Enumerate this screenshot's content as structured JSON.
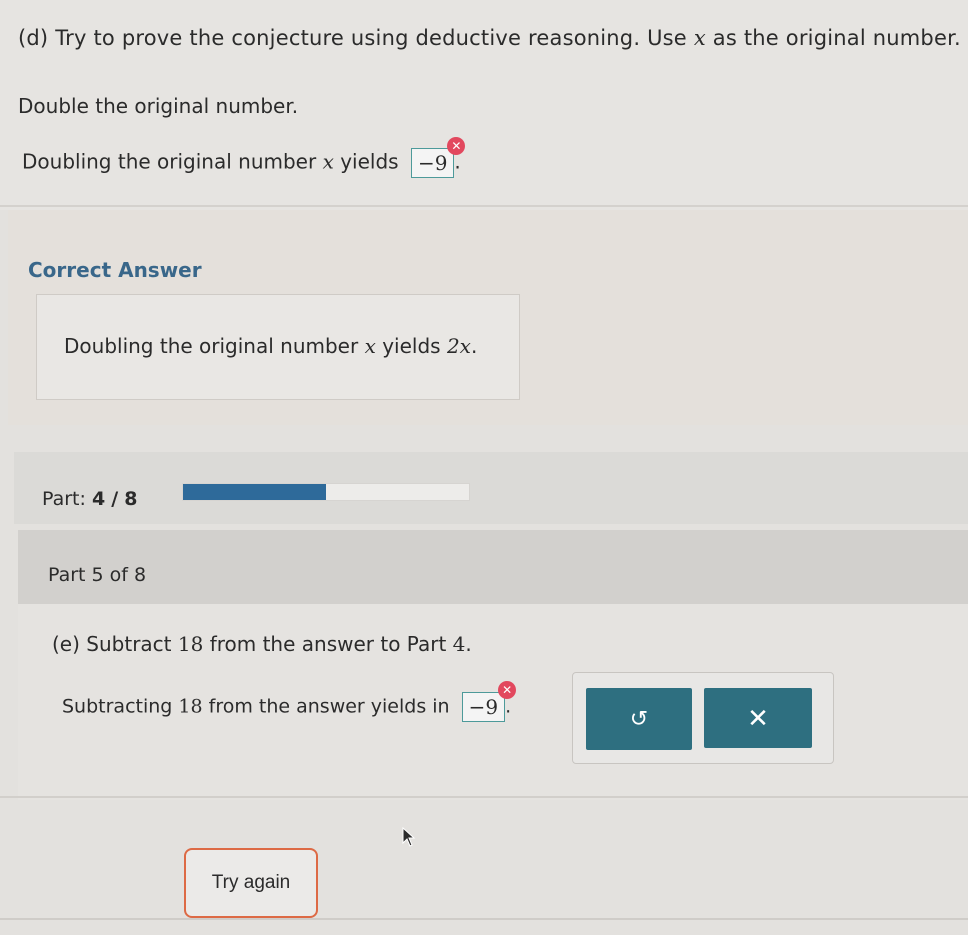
{
  "part_d": {
    "label": "(d)",
    "question": "Try to prove the conjecture using deductive reasoning. Use",
    "var": "x",
    "question_end": "as the original number.",
    "instruction": "Double the original number.",
    "prompt_pre": "Doubling the original number",
    "prompt_mid": "yields",
    "entered_answer": "−9",
    "prompt_end": "."
  },
  "correct_answer": {
    "title": "Correct Answer",
    "text_pre": "Doubling the original number",
    "var": "x",
    "text_mid": "yields",
    "answer": "2x",
    "text_end": "."
  },
  "progress": {
    "label": "Part:",
    "current": "4",
    "sep": "/",
    "total": "8",
    "fraction": 0.5
  },
  "part_e": {
    "header": "Part 5 of 8",
    "label": "(e)",
    "q_pre": "Subtract",
    "q_num": "18",
    "q_post": "from the answer to Part",
    "q_part": "4",
    "q_end": ".",
    "prompt_pre": "Subtracting",
    "prompt_num": "18",
    "prompt_post": "from the answer yields in",
    "entered_answer": "−9",
    "prompt_end": "."
  },
  "buttons": {
    "undo": "↺",
    "clear": "✕",
    "try_again": "Try again"
  },
  "icons": {
    "error": "✕"
  }
}
